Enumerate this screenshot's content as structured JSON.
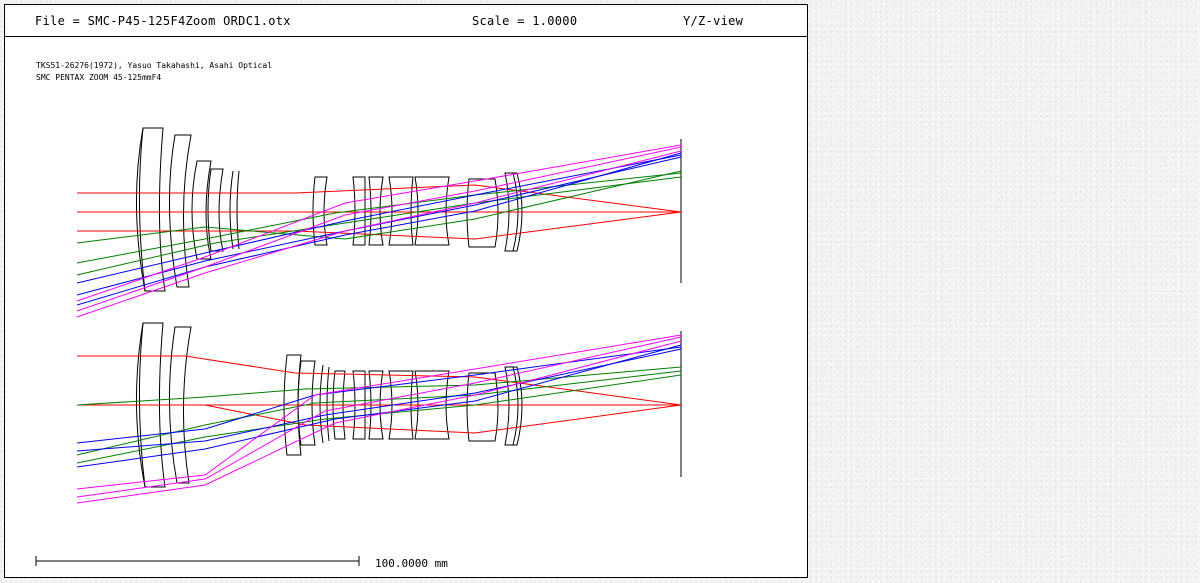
{
  "header": {
    "file": "File = SMC-P45-125F4Zoom ORDC1.otx",
    "scale": "Scale = 1.0000",
    "view": "Y/Z-view"
  },
  "notes": {
    "line1": "TKS51-26276(1972), Yasuo Takahashi, Asahi Optical",
    "line2": "SMC PENTAX ZOOM 45-125mmF4"
  },
  "scale_bar": {
    "label": "100.0000 mm"
  },
  "colors": {
    "axial": "#ff0000",
    "field_mid": "#008000",
    "field_edge": "#0000ff",
    "field_full": "#ff00ff",
    "lens": "#000000"
  }
}
